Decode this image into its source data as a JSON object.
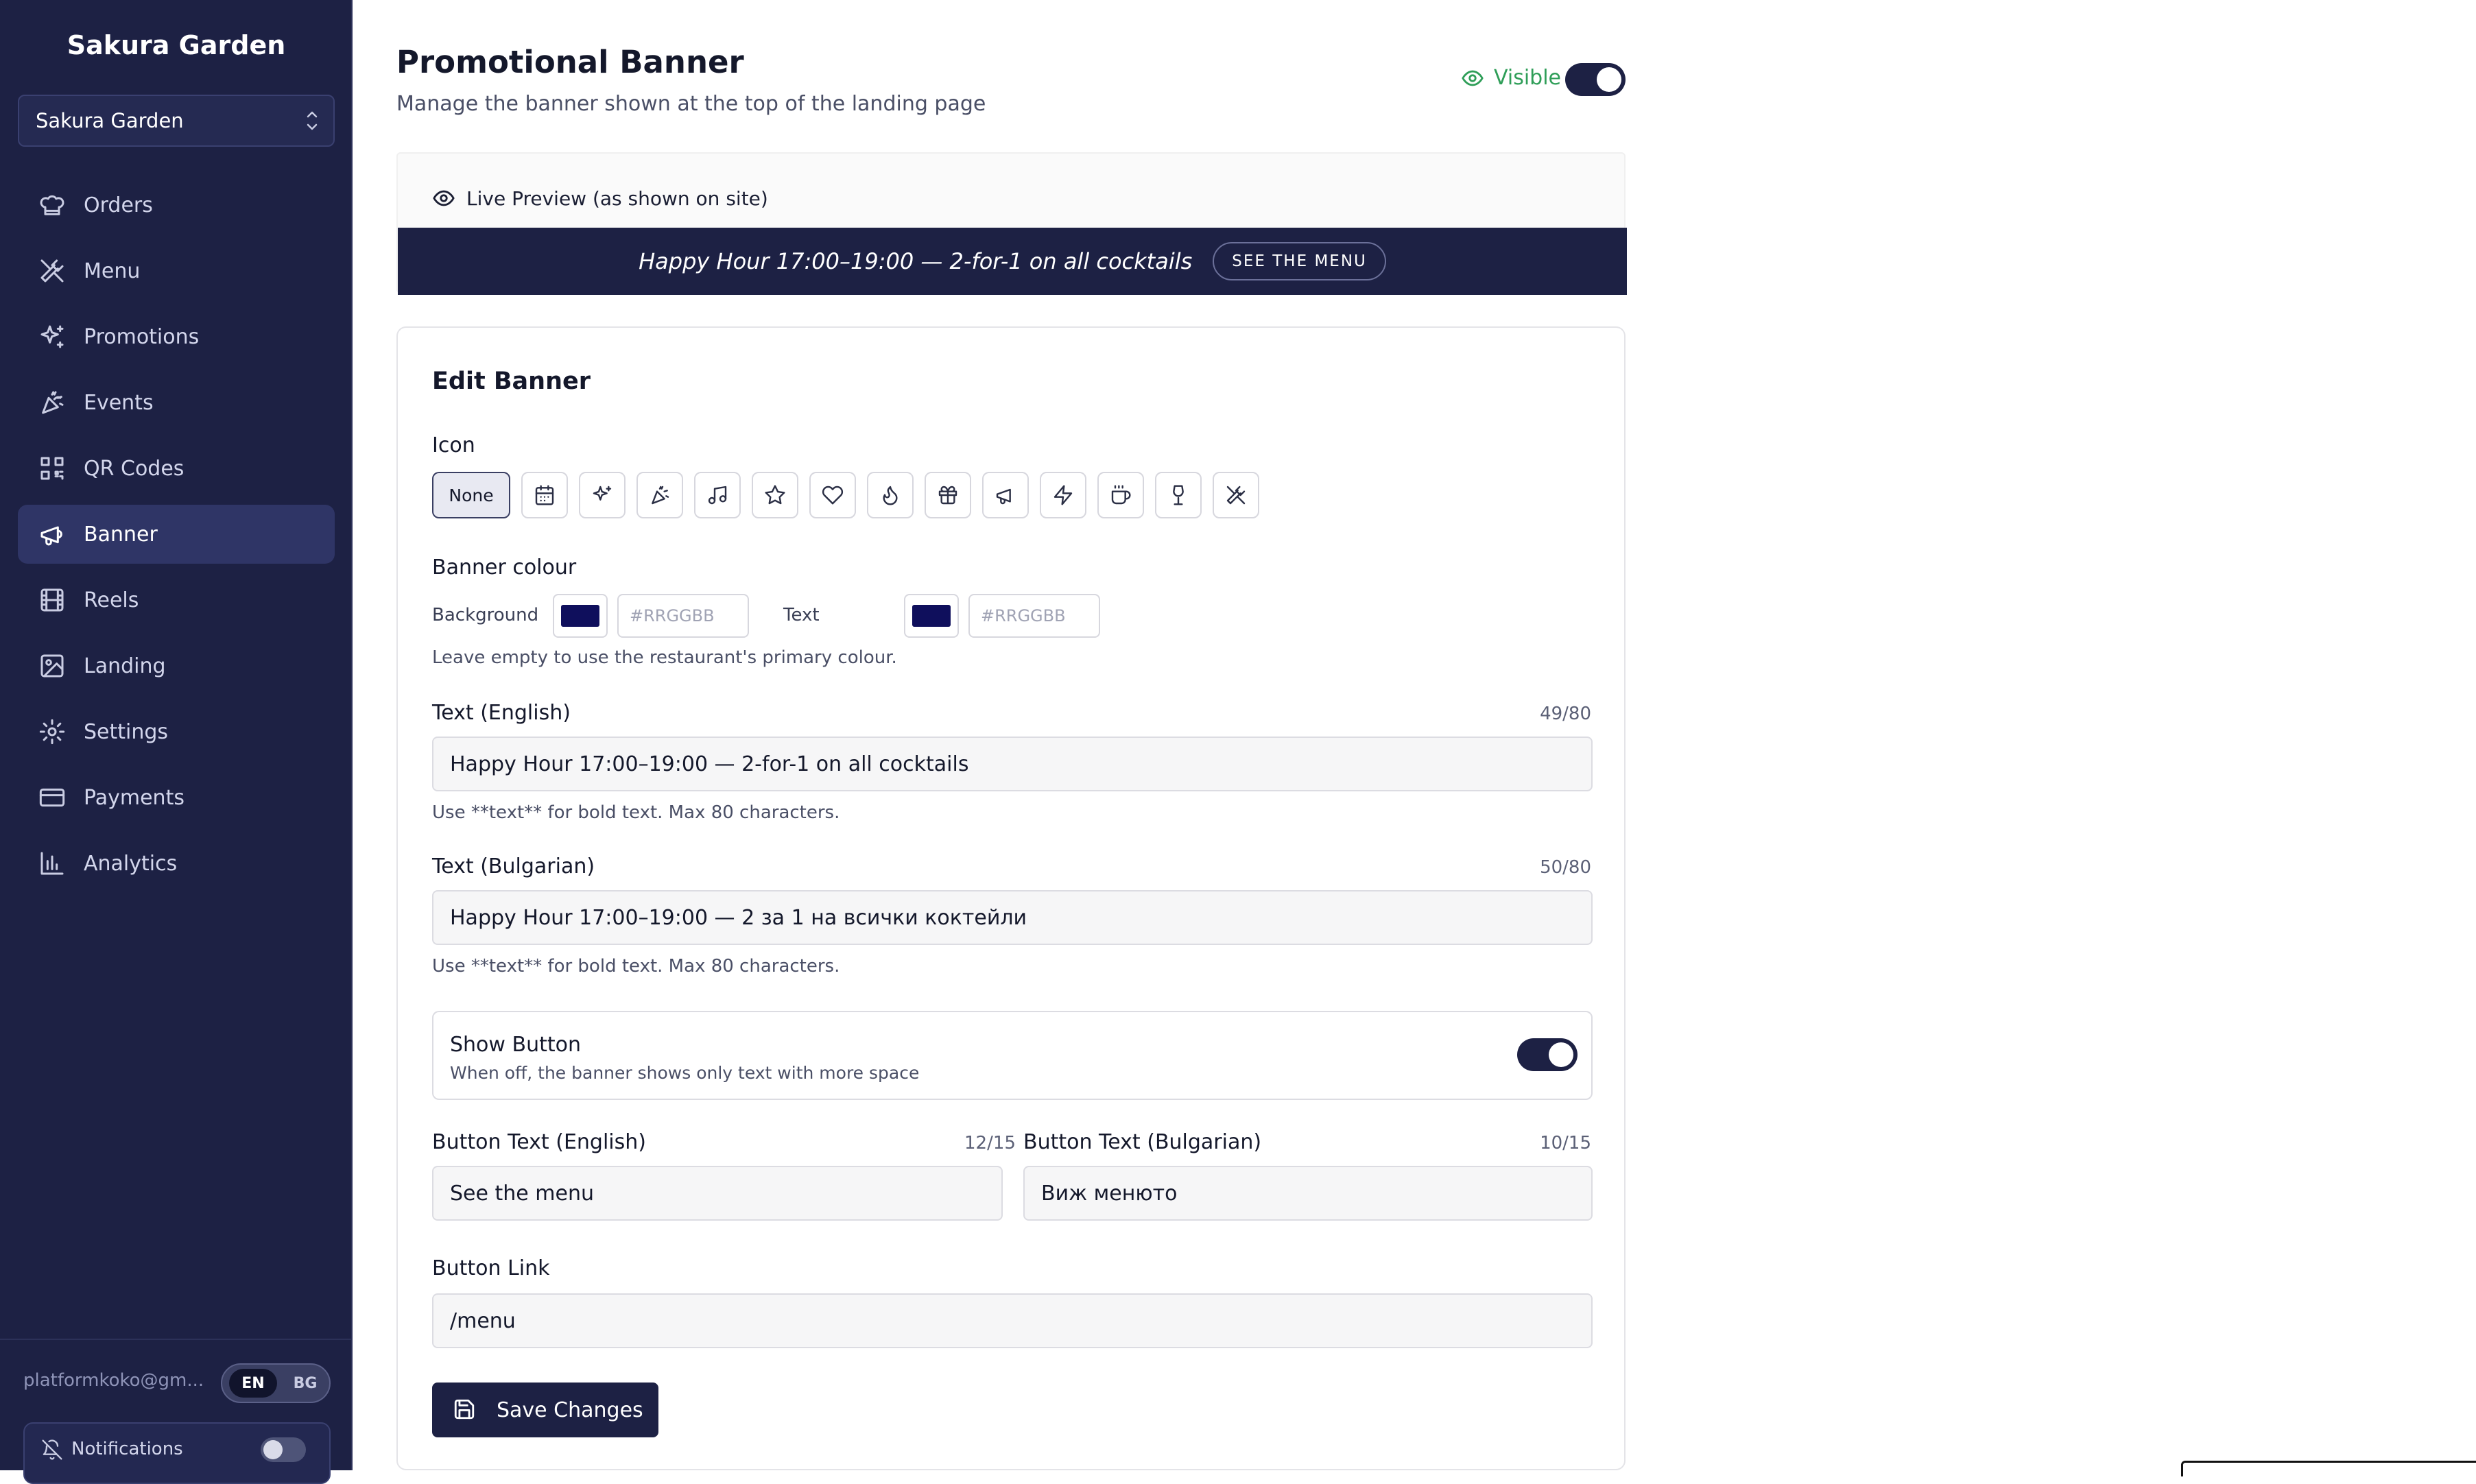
{
  "sidebar": {
    "brand": "Sakura Garden",
    "restaurant_select": "Sakura Garden",
    "items": [
      {
        "label": "Orders",
        "icon": "chef-hat-icon"
      },
      {
        "label": "Menu",
        "icon": "utensils-icon"
      },
      {
        "label": "Promotions",
        "icon": "sparkles-icon"
      },
      {
        "label": "Events",
        "icon": "party-popper-icon"
      },
      {
        "label": "QR Codes",
        "icon": "qr-code-icon"
      },
      {
        "label": "Banner",
        "icon": "megaphone-icon",
        "active": true
      },
      {
        "label": "Reels",
        "icon": "film-icon"
      },
      {
        "label": "Landing",
        "icon": "image-icon"
      },
      {
        "label": "Settings",
        "icon": "gear-icon"
      },
      {
        "label": "Payments",
        "icon": "credit-card-icon"
      },
      {
        "label": "Analytics",
        "icon": "bar-chart-icon"
      }
    ],
    "email": "platformkoko@gm...",
    "lang_en": "EN",
    "lang_bg": "BG",
    "notifications_label": "Notifications"
  },
  "header": {
    "title": "Promotional Banner",
    "subtitle": "Manage the banner shown at the top of the landing page",
    "visible_label": "Visible"
  },
  "preview": {
    "label": "Live Preview (as shown on site)",
    "banner_text": "Happy Hour 17:00–19:00 — 2-for-1 on all cocktails",
    "banner_button": "SEE THE MENU"
  },
  "edit": {
    "title": "Edit Banner",
    "icon_label": "Icon",
    "icon_none": "None",
    "icon_options": [
      "calendar-icon",
      "sparkles-icon",
      "party-popper-icon",
      "music-icon",
      "star-icon",
      "heart-icon",
      "flame-icon",
      "gift-icon",
      "megaphone-icon",
      "zap-icon",
      "coffee-icon",
      "wine-icon",
      "utensils-icon"
    ],
    "colour_label": "Banner colour",
    "background_label": "Background",
    "text_label": "Text",
    "hex_placeholder": "#RRGGBB",
    "colour_hint": "Leave empty to use the restaurant's primary colour.",
    "swatch_color": "#0f0f5c",
    "text_en_label": "Text (English)",
    "text_en_counter": "49/80",
    "text_en_value": "Happy Hour 17:00–19:00 — 2-for-1 on all cocktails",
    "text_hint": "Use **text** for bold text. Max 80 characters.",
    "text_bg_label": "Text (Bulgarian)",
    "text_bg_counter": "50/80",
    "text_bg_value": "Happy Hour 17:00–19:00 — 2 за 1 на всички коктейли",
    "show_button_title": "Show Button",
    "show_button_desc": "When off, the banner shows only text with more space",
    "btn_en_label": "Button Text (English)",
    "btn_en_counter": "12/15",
    "btn_en_value": "See the menu",
    "btn_bg_label": "Button Text (Bulgarian)",
    "btn_bg_counter": "10/15",
    "btn_bg_value": "Виж менюто",
    "link_label": "Button Link",
    "link_value": "/menu",
    "save_label": "Save Changes"
  },
  "colors": {
    "navy": "#1d2144",
    "visible_green": "#2f9e58"
  }
}
